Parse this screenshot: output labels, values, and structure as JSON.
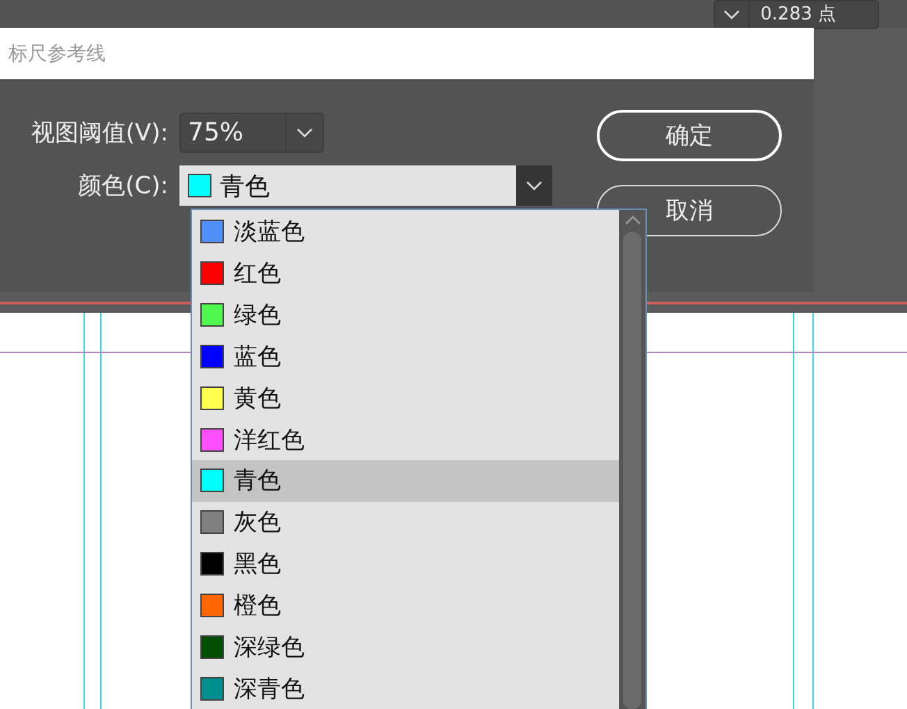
{
  "toolbar": {
    "stroke_weight": "0.283 点"
  },
  "dialog": {
    "title": "标尺参考线",
    "fields": [
      {
        "kind": "percent",
        "label": "视图阈值(V):",
        "value": "75%"
      },
      {
        "kind": "color",
        "label": "颜色(C):",
        "value": "青色"
      }
    ],
    "buttons": [
      {
        "label": "确定",
        "default": true
      },
      {
        "label": "取消",
        "default": false
      }
    ]
  },
  "color_list": [
    {
      "name": "淡蓝色",
      "color": "#4f8ff7",
      "selected": false
    },
    {
      "name": "红色",
      "color": "#ff0000",
      "selected": false
    },
    {
      "name": "绿色",
      "color": "#4ff74f",
      "selected": false
    },
    {
      "name": "蓝色",
      "color": "#0000ff",
      "selected": false
    },
    {
      "name": "黄色",
      "color": "#ffff4f",
      "selected": false
    },
    {
      "name": "洋红色",
      "color": "#ff4fff",
      "selected": false
    },
    {
      "name": "青色",
      "color": "#00ffff",
      "selected": true
    },
    {
      "name": "灰色",
      "color": "#808080",
      "selected": false
    },
    {
      "name": "黑色",
      "color": "#000000",
      "selected": false
    },
    {
      "name": "橙色",
      "color": "#ff6600",
      "selected": false
    },
    {
      "name": "深绿色",
      "color": "#004f00",
      "selected": false
    },
    {
      "name": "深青色",
      "color": "#008f8f",
      "selected": false
    }
  ]
}
